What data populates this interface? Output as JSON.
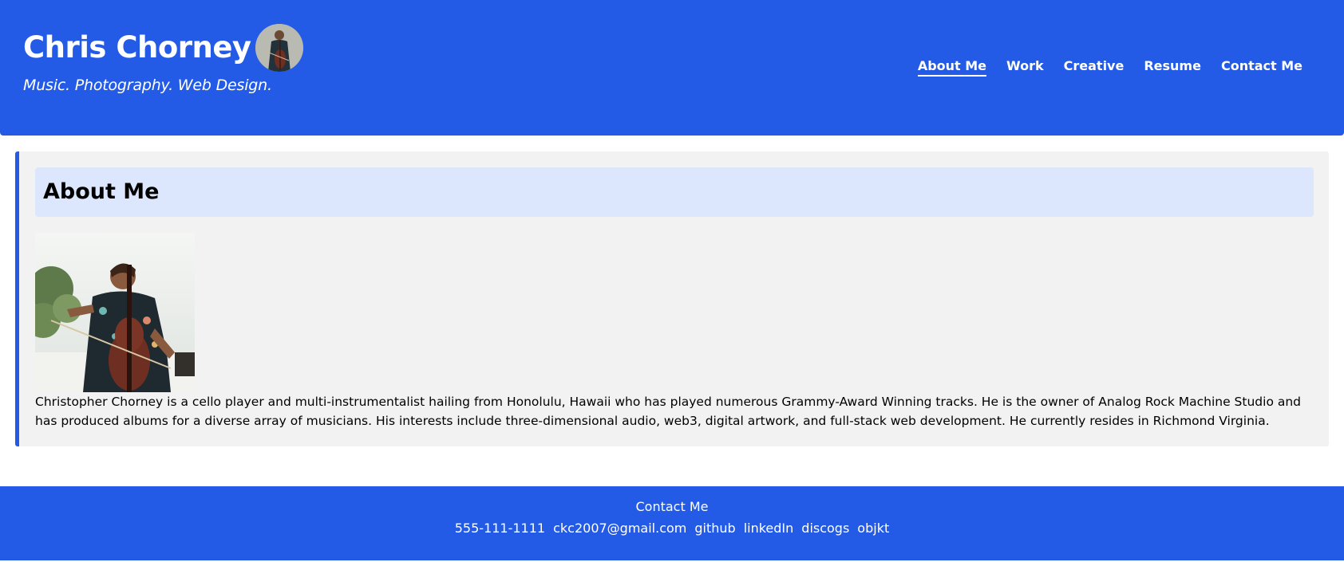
{
  "header": {
    "title": "Chris Chorney",
    "tagline": "Music. Photography. Web Design.",
    "nav": [
      {
        "label": "About Me",
        "active": true
      },
      {
        "label": "Work",
        "active": false
      },
      {
        "label": "Creative",
        "active": false
      },
      {
        "label": "Resume",
        "active": false
      },
      {
        "label": "Contact Me",
        "active": false
      }
    ]
  },
  "about": {
    "heading": "About Me",
    "bio": "Christopher Chorney is a cello player and multi-instrumentalist hailing from Honolulu, Hawaii who has played numerous Grammy-Award Winning tracks. He is the owner of Analog Rock Machine Studio and has produced albums for a diverse array of musicians. His interests include three-dimensional audio, web3, digital artwork, and full-stack web development. He currently resides in Richmond Virginia."
  },
  "footer": {
    "title": "Contact Me",
    "links": [
      "555-111-1111",
      "ckc2007@gmail.com",
      "github",
      "linkedIn",
      "discogs",
      "objkt"
    ]
  },
  "colors": {
    "primary": "#245be6",
    "section_bg": "#f2f2f2",
    "heading_bg": "#dce7fd"
  }
}
